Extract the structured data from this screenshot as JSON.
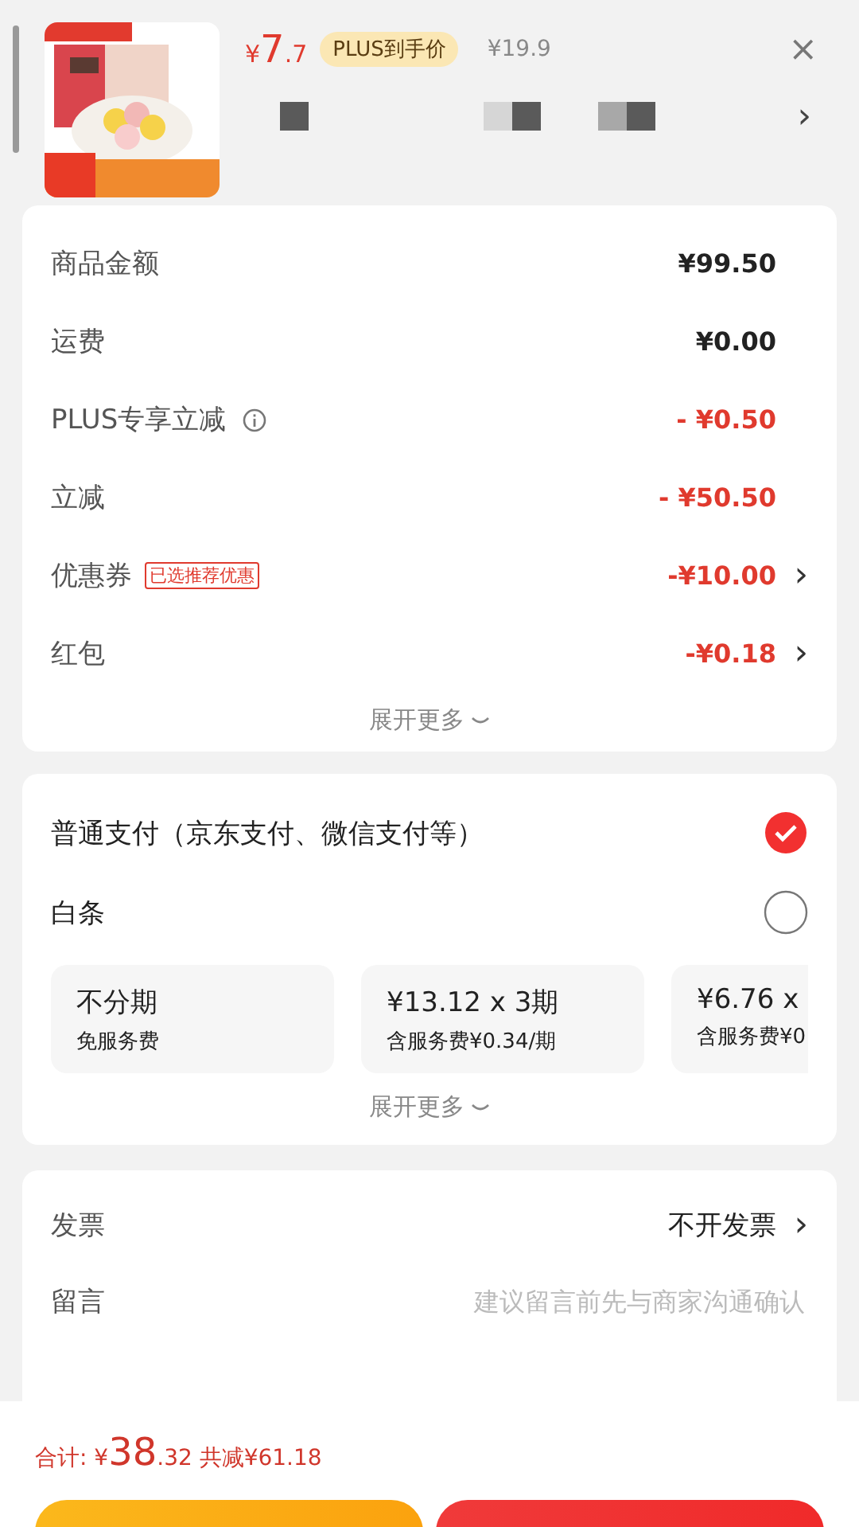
{
  "product": {
    "price_symbol": "¥",
    "price_int": "7",
    "price_dec": ".7",
    "price_tag": "PLUS到手价",
    "original_price": "¥19.9",
    "close": "×",
    "more": "›"
  },
  "summary": {
    "rows": [
      {
        "label": "商品金额",
        "value": "¥99.50",
        "red": false,
        "info": false
      },
      {
        "label": "运费",
        "value": "¥0.00",
        "red": false,
        "info": false
      },
      {
        "label": "PLUS专享立减",
        "value": "- ¥0.50",
        "red": true,
        "info": true
      },
      {
        "label": "立减",
        "value": "- ¥50.50",
        "red": true,
        "info": false
      },
      {
        "label": "优惠券",
        "value": "-¥10.00",
        "red": true,
        "info": false,
        "badge": "已选推荐优惠",
        "arrow": "›"
      },
      {
        "label": "红包",
        "value": "-¥0.18",
        "red": true,
        "info": false,
        "arrow": "›"
      }
    ],
    "expand": "展开更多"
  },
  "payment": {
    "methods": [
      {
        "label": "普通支付（京东支付、微信支付等）",
        "selected": true
      },
      {
        "label": "白条",
        "selected": false
      }
    ],
    "plans": [
      {
        "title": "不分期",
        "sub": "免服务费"
      },
      {
        "title": "¥13.12 x 3期",
        "sub": "含服务费¥0.34/期"
      },
      {
        "title": "¥6.76 x",
        "sub": "含服务费¥0"
      }
    ],
    "expand": "展开更多"
  },
  "extra": {
    "rows": [
      {
        "label": "发票",
        "value": "不开发票",
        "arrow": "›",
        "kind": "link"
      },
      {
        "label": "留言",
        "placeholder": "建议留言前先与商家沟通确认",
        "kind": "input"
      }
    ]
  },
  "footer": {
    "total_label": "合计:",
    "symbol": "¥",
    "total_int": "38",
    "total_dec": ".32",
    "saved": "共减¥61.18"
  }
}
